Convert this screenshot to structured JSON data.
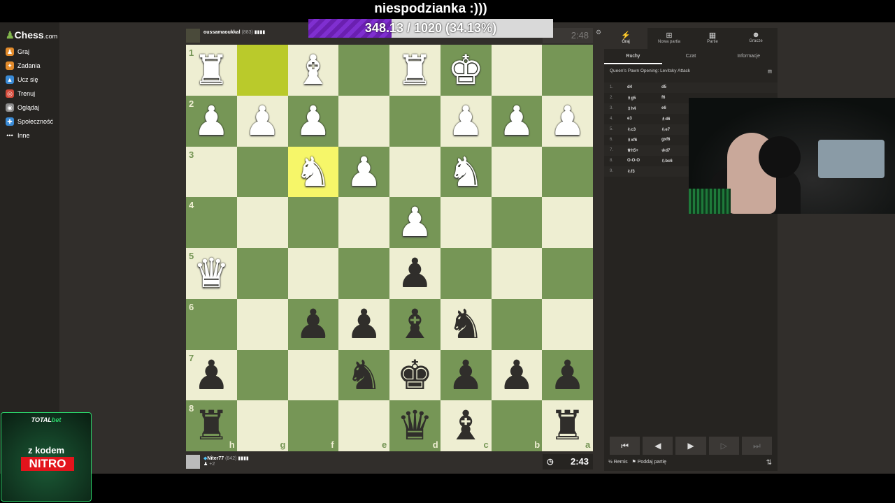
{
  "stream": {
    "title": "niespodzianka :)))",
    "progress_text": "348.13 / 1020 (34.13%)",
    "progress_fraction": 0.3413
  },
  "sidebar": {
    "logo_text": "Chess",
    "logo_suffix": ".com",
    "items": [
      {
        "label": "Graj",
        "icon": "play-icon",
        "color": "#e28b2b"
      },
      {
        "label": "Zadania",
        "icon": "puzzle-icon",
        "color": "#e28b2b"
      },
      {
        "label": "Ucz się",
        "icon": "learn-icon",
        "color": "#3a8bd6"
      },
      {
        "label": "Trenuj",
        "icon": "train-icon",
        "color": "#d24a3a"
      },
      {
        "label": "Oglądaj",
        "icon": "watch-icon",
        "color": "#8b8b8b"
      },
      {
        "label": "Społeczność",
        "icon": "community-icon",
        "color": "#3a8bd6"
      },
      {
        "label": "Inne",
        "icon": "more-icon",
        "color": "#8b8b8b"
      }
    ]
  },
  "top_player": {
    "name": "oussamaoukkal",
    "rating": "(883)",
    "clock": "2:48"
  },
  "bottom_player": {
    "name": "Niter77",
    "rating": "(842)",
    "captured": "+2",
    "clock": "2:43"
  },
  "board": {
    "ranks": [
      "1",
      "2",
      "3",
      "4",
      "5",
      "6",
      "7",
      "8"
    ],
    "files": [
      "h",
      "g",
      "f",
      "e",
      "d",
      "c",
      "b",
      "a"
    ],
    "highlights": [
      [
        0,
        1
      ],
      [
        2,
        2
      ]
    ],
    "pieces": [
      {
        "r": 0,
        "c": 0,
        "p": "♜",
        "color": "w"
      },
      {
        "r": 0,
        "c": 2,
        "p": "♝",
        "color": "w"
      },
      {
        "r": 0,
        "c": 4,
        "p": "♜",
        "color": "w"
      },
      {
        "r": 0,
        "c": 5,
        "p": "♚",
        "color": "w"
      },
      {
        "r": 1,
        "c": 0,
        "p": "♟",
        "color": "w"
      },
      {
        "r": 1,
        "c": 1,
        "p": "♟",
        "color": "w"
      },
      {
        "r": 1,
        "c": 2,
        "p": "♟",
        "color": "w"
      },
      {
        "r": 1,
        "c": 5,
        "p": "♟",
        "color": "w"
      },
      {
        "r": 1,
        "c": 6,
        "p": "♟",
        "color": "w"
      },
      {
        "r": 1,
        "c": 7,
        "p": "♟",
        "color": "w"
      },
      {
        "r": 2,
        "c": 2,
        "p": "♞",
        "color": "w"
      },
      {
        "r": 2,
        "c": 3,
        "p": "♟",
        "color": "w"
      },
      {
        "r": 2,
        "c": 5,
        "p": "♞",
        "color": "w"
      },
      {
        "r": 3,
        "c": 4,
        "p": "♟",
        "color": "w"
      },
      {
        "r": 4,
        "c": 0,
        "p": "♛",
        "color": "w"
      },
      {
        "r": 4,
        "c": 4,
        "p": "♟",
        "color": "b"
      },
      {
        "r": 5,
        "c": 2,
        "p": "♟",
        "color": "b"
      },
      {
        "r": 5,
        "c": 3,
        "p": "♟",
        "color": "b"
      },
      {
        "r": 5,
        "c": 4,
        "p": "♝",
        "color": "b"
      },
      {
        "r": 5,
        "c": 5,
        "p": "♞",
        "color": "b"
      },
      {
        "r": 6,
        "c": 0,
        "p": "♟",
        "color": "b"
      },
      {
        "r": 6,
        "c": 3,
        "p": "♞",
        "color": "b"
      },
      {
        "r": 6,
        "c": 4,
        "p": "♚",
        "color": "b"
      },
      {
        "r": 6,
        "c": 5,
        "p": "♟",
        "color": "b"
      },
      {
        "r": 6,
        "c": 6,
        "p": "♟",
        "color": "b"
      },
      {
        "r": 6,
        "c": 7,
        "p": "♟",
        "color": "b"
      },
      {
        "r": 7,
        "c": 0,
        "p": "♜",
        "color": "b"
      },
      {
        "r": 7,
        "c": 4,
        "p": "♛",
        "color": "b"
      },
      {
        "r": 7,
        "c": 5,
        "p": "♝",
        "color": "b"
      },
      {
        "r": 7,
        "c": 7,
        "p": "♜",
        "color": "b"
      }
    ]
  },
  "panel": {
    "tabs": [
      {
        "label": "Graj",
        "icon": "lightning-icon"
      },
      {
        "label": "Nowa partia",
        "icon": "plus-icon"
      },
      {
        "label": "Partie",
        "icon": "board-icon"
      },
      {
        "label": "Gracze",
        "icon": "players-icon"
      }
    ],
    "subtabs": [
      "Ruchy",
      "Czat",
      "Informacje"
    ],
    "opening": "Queen's Pawn Opening: Levitsky Attack",
    "moves": [
      {
        "n": "1.",
        "w": "d4",
        "b": "d5"
      },
      {
        "n": "2.",
        "w": "♗g5",
        "b": "f6"
      },
      {
        "n": "3.",
        "w": "♗h4",
        "b": "e6"
      },
      {
        "n": "4.",
        "w": "e3",
        "b": "♗d6"
      },
      {
        "n": "5.",
        "w": "♘c3",
        "b": "♘e7"
      },
      {
        "n": "6.",
        "w": "♗xf6",
        "b": "gxf6"
      },
      {
        "n": "7.",
        "w": "♕h5+",
        "b": "♔d7"
      },
      {
        "n": "8.",
        "w": "O-O-O",
        "b": "♘bc6"
      },
      {
        "n": "9.",
        "w": "♘f3",
        "b": ""
      }
    ],
    "nav_buttons": [
      "⏮",
      "◀",
      "▶",
      "▷",
      "⏭"
    ],
    "draw_label": "Remis",
    "resign_label": "Poddaj partię",
    "draw_icon": "½"
  },
  "promo": {
    "brand_main": "TOTAL",
    "brand_accent": "bet",
    "line": "z kodem",
    "code": "NITRO"
  }
}
